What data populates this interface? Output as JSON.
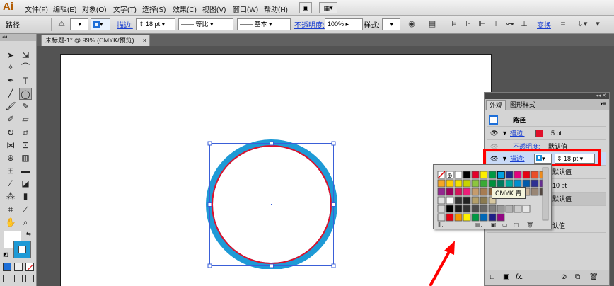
{
  "app": {
    "logo": "Ai"
  },
  "menubar": {
    "items": [
      "文件(F)",
      "编辑(E)",
      "对象(O)",
      "文字(T)",
      "选择(S)",
      "效果(C)",
      "视图(V)",
      "窗口(W)",
      "帮助(H)"
    ]
  },
  "controlbar": {
    "path_label": "路径",
    "stroke_label": "描边:",
    "stroke_weight": "18 pt",
    "profile_equal": "等比",
    "brush_basic": "基本",
    "opacity_label": "不透明度:",
    "opacity_value": "100%",
    "style_label": "样式:",
    "transform_label": "变换"
  },
  "tabs": {
    "document": "未标题-1* @ 99% (CMYK/预览)",
    "close": "×"
  },
  "tools": {
    "collapse": "◂◂"
  },
  "appearance_panel": {
    "topbar": "◂◂ ✕",
    "tab_appearance": "外观",
    "tab_graphic_styles": "图形样式",
    "menu_icon": "▾≡",
    "title": "路径",
    "rows": [
      {
        "label": "描边:",
        "value": "5 pt",
        "color": "#e0102a"
      },
      {
        "label": "不透明度:",
        "value": "默认值"
      },
      {
        "label": "描边:",
        "value": "18 pt",
        "color": "#1e8fd8"
      },
      {
        "label": "",
        "value": "默认值"
      },
      {
        "label": "",
        "value": "10 pt"
      },
      {
        "label": "",
        "value": "默认值"
      },
      {
        "label": "",
        "value": ""
      },
      {
        "label": "",
        "value": "认值"
      }
    ]
  },
  "swatch_popup": {
    "tooltip": "CMYK 青"
  },
  "colors": {
    "outer_ring": "#1e9ad6",
    "inner_ring": "#e0102a",
    "highlight": "#ff0000",
    "selection": "#3a5fd8"
  }
}
